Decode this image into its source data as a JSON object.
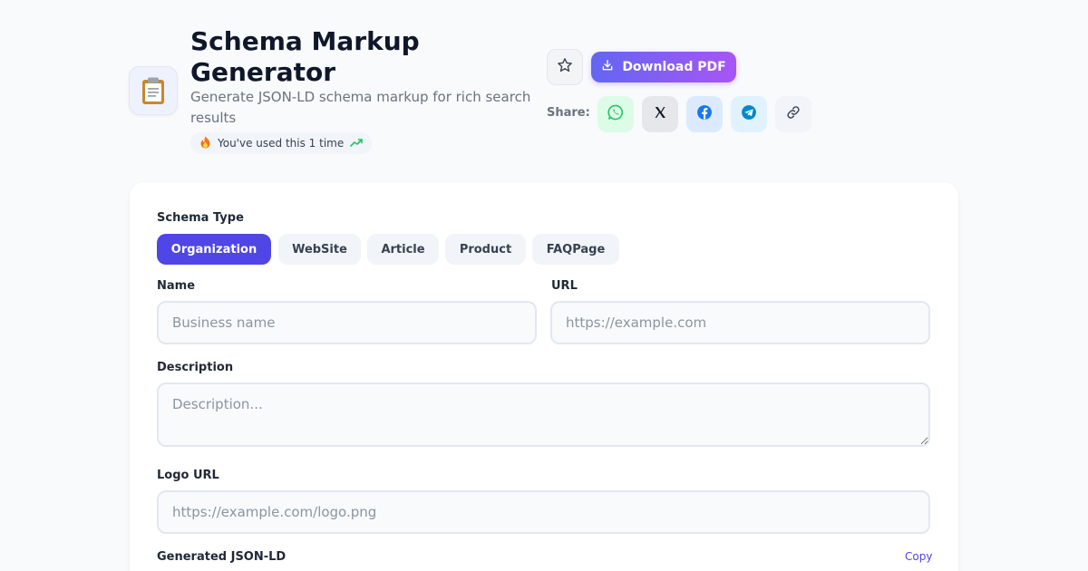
{
  "header": {
    "app_icon": "clipboard-icon",
    "title": "Schema Markup Generator",
    "subtitle": "Generate JSON-LD schema markup for rich search results",
    "usage_badge": "You've used this 1 time",
    "download_label": "Download PDF",
    "share_label": "Share:",
    "share_icons": [
      "whatsapp-icon",
      "x-icon",
      "facebook-icon",
      "telegram-icon",
      "link-icon"
    ]
  },
  "form": {
    "schema_type_label": "Schema Type",
    "tabs": [
      {
        "label": "Organization",
        "active": true
      },
      {
        "label": "WebSite",
        "active": false
      },
      {
        "label": "Article",
        "active": false
      },
      {
        "label": "Product",
        "active": false
      },
      {
        "label": "FAQPage",
        "active": false
      }
    ],
    "name_label": "Name",
    "name_placeholder": "Business name",
    "name_value": "",
    "url_label": "URL",
    "url_placeholder": "https://example.com",
    "url_value": "",
    "description_label": "Description",
    "description_placeholder": "Description...",
    "description_value": "",
    "logo_label": "Logo URL",
    "logo_placeholder": "https://example.com/logo.png",
    "logo_value": "",
    "output_label": "Generated JSON-LD",
    "copy_label": "Copy"
  },
  "colors": {
    "accent": "#4f46e5",
    "gradient_start": "#6366f1",
    "gradient_end": "#a855f7",
    "whatsapp": "#22c55e",
    "facebook": "#1877f2",
    "telegram": "#0088cc"
  }
}
